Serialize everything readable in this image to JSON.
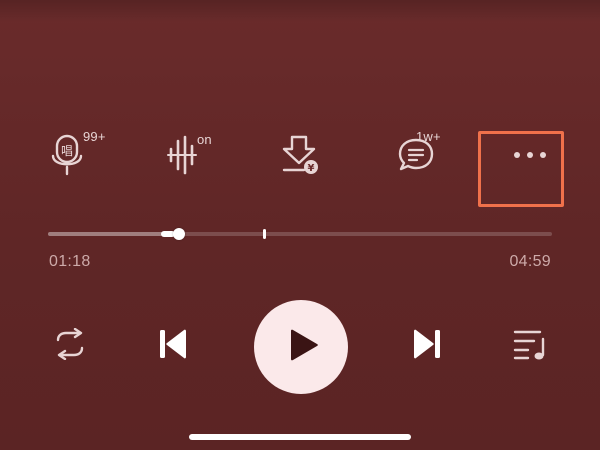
{
  "actions": {
    "karaoke": {
      "badge": "99+",
      "icon": "karaoke-mic-icon",
      "glyph": "唱"
    },
    "sound_effect": {
      "badge": "on",
      "icon": "sound-effect-icon"
    },
    "download": {
      "icon": "paid-download-icon",
      "glyph": "¥"
    },
    "comments": {
      "badge": "1w+",
      "icon": "comment-icon"
    },
    "more": {
      "icon": "more-dots-icon"
    }
  },
  "playback": {
    "current_time": "01:18",
    "total_time": "04:59",
    "progress_fraction": 0.26,
    "marker_fraction": 0.427
  },
  "controls": {
    "repeat": "repeat-icon",
    "previous": "previous-track-icon",
    "play": "play-icon",
    "next": "next-track-icon",
    "playlist": "playlist-icon"
  },
  "colors": {
    "background": "#5f2626",
    "highlight": "#f0714b",
    "play_button": "#fbe9ea"
  }
}
